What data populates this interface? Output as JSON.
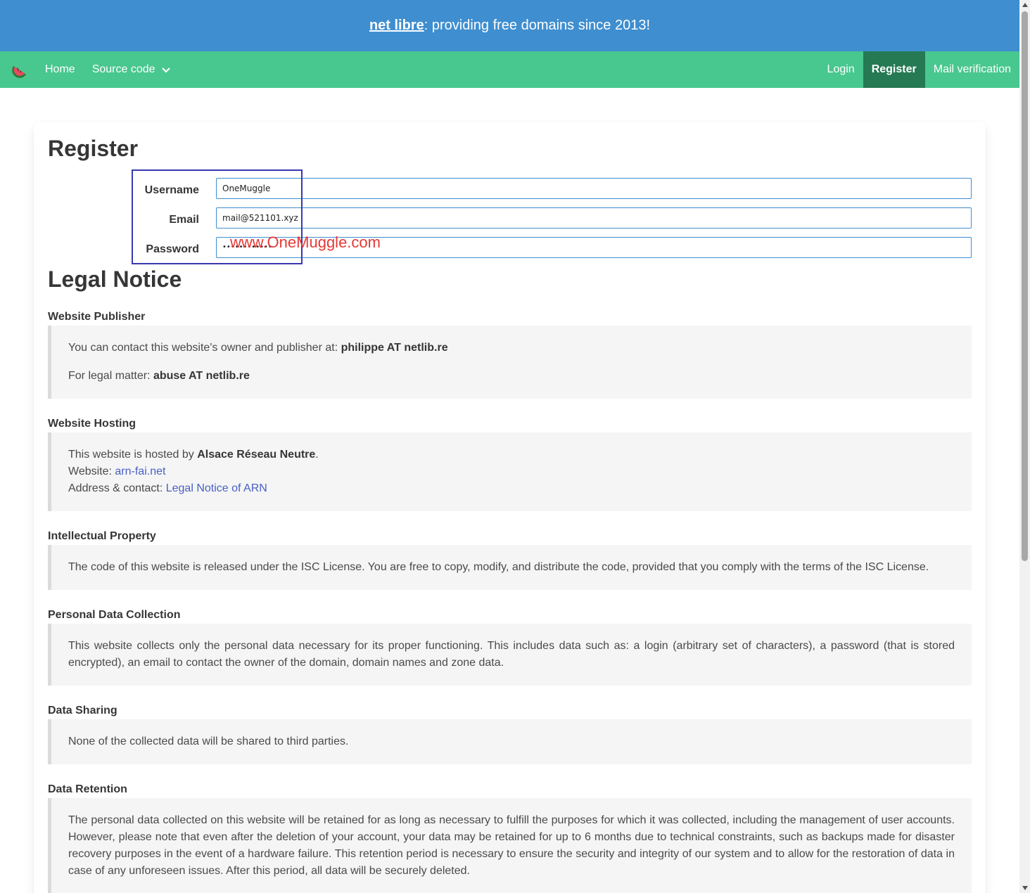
{
  "banner": {
    "brand_link": "net libre",
    "tagline": ": providing free domains since 2013!"
  },
  "navbar": {
    "home": "Home",
    "source_code": "Source code",
    "login": "Login",
    "register": "Register",
    "mail_verification": "Mail verification"
  },
  "register": {
    "title": "Register",
    "username_label": "Username",
    "username_value": "OneMuggle",
    "email_label": "Email",
    "email_value": "mail@521101.xyz",
    "password_label": "Password",
    "password_mask": "••••••••••••"
  },
  "watermark": "www.OneMuggle.com",
  "legal": {
    "title": "Legal Notice",
    "publisher": {
      "title": "Website Publisher",
      "line1_prefix": "You can contact this website's owner and publisher at: ",
      "line1_contact": "philippe AT netlib.re",
      "line2_prefix": "For legal matter: ",
      "line2_contact": "abuse AT netlib.re"
    },
    "hosting": {
      "title": "Website Hosting",
      "line1_prefix": "This website is hosted by ",
      "host_name": "Alsace Réseau Neutre",
      "line1_suffix": ".",
      "website_label": "Website: ",
      "website_link": "arn-fai.net",
      "address_label": "Address & contact: ",
      "address_link": "Legal Notice of ARN"
    },
    "ip": {
      "title": "Intellectual Property",
      "text": "The code of this website is released under the ISC License. You are free to copy, modify, and distribute the code, provided that you comply with the terms of the ISC License."
    },
    "data_collection": {
      "title": "Personal Data Collection",
      "text": "This website collects only the personal data necessary for its proper functioning. This includes data such as: a login (arbitrary set of characters), a password (that is stored encrypted), an email to contact the owner of the domain, domain names and zone data."
    },
    "data_sharing": {
      "title": "Data Sharing",
      "text": "None of the collected data will be shared to third parties."
    },
    "data_retention": {
      "title": "Data Retention",
      "text": "The personal data collected on this website will be retained for as long as necessary to fulfill the purposes for which it was collected, including the management of user accounts. However, please note that even after the deletion of your account, your data may be retained for up to 6 months due to technical constraints, such as backups made for disaster recovery purposes in the event of a hardware failure. This retention period is necessary to ensure the security and integrity of our system and to allow for the restoration of data in case of any unforeseen issues. After this period, all data will be securely deleted."
    }
  },
  "colors": {
    "banner": "#3e8ed0",
    "navbar": "#48c78e",
    "nav_active": "#257953",
    "link": "#485fc7"
  }
}
